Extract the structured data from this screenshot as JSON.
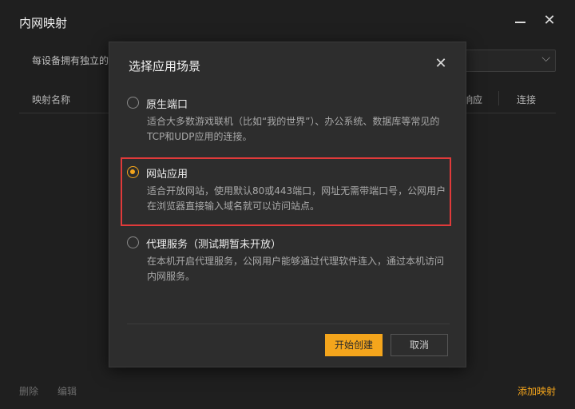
{
  "window": {
    "title": "内网映射",
    "description": "每设备拥有独立的",
    "minimize_icon": "minimize-icon",
    "close_icon": "close-icon"
  },
  "table": {
    "headers": [
      "映射名称",
      "响应",
      "连接"
    ]
  },
  "footer": {
    "delete_label": "删除",
    "edit_label": "编辑",
    "add_label": "添加映射"
  },
  "modal": {
    "title": "选择应用场景",
    "options": [
      {
        "label": "原生端口",
        "description": "适合大多数游戏联机（比如“我的世界”）、办公系统、数据库等常见的TCP和UDP应用的连接。",
        "selected": false
      },
      {
        "label": "网站应用",
        "description": "适合开放网站，使用默认80或443端口，网址无需带端口号，公网用户在浏览器直接输入域名就可以访问站点。",
        "selected": true
      },
      {
        "label": "代理服务（测试期暂未开放）",
        "description": "在本机开启代理服务，公网用户能够通过代理软件连入，通过本机访问内网服务。",
        "selected": false
      }
    ],
    "primary_button": "开始创建",
    "cancel_button": "取消"
  },
  "colors": {
    "accent": "#f4a51c",
    "highlight_border": "#e03a3a",
    "background": "#1f1f1f",
    "modal_background": "#2d2d2d"
  }
}
